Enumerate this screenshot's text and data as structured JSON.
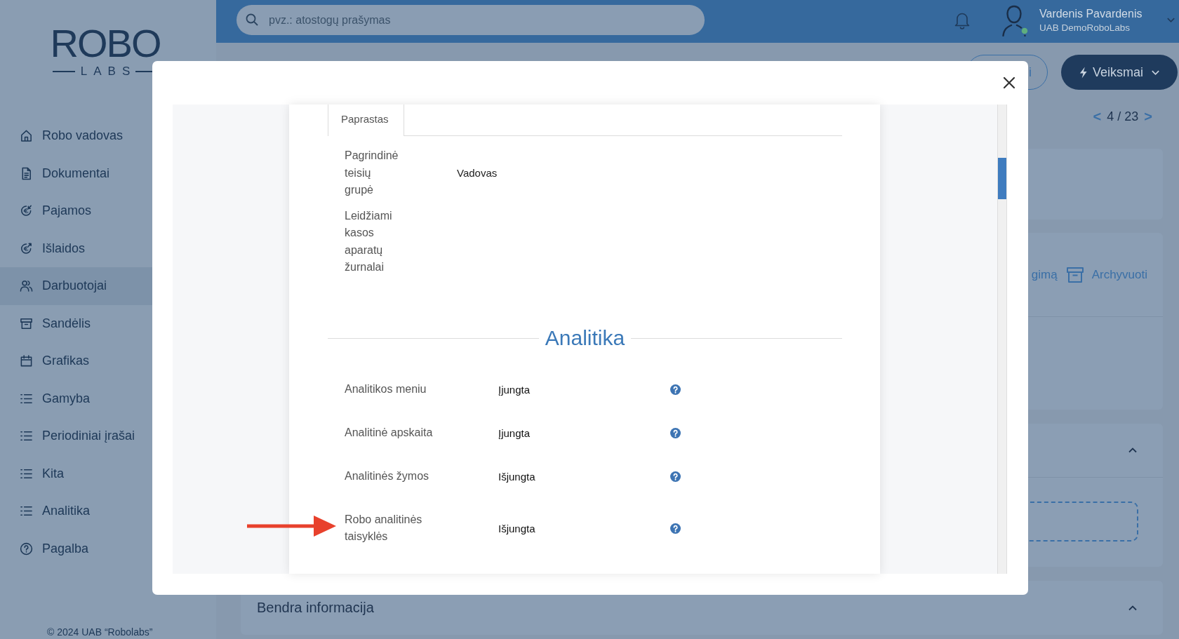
{
  "sidebar": {
    "logo": {
      "wordmark": "ROBO",
      "tagline": "LABS"
    },
    "items": [
      {
        "label": "Robo vadovas",
        "selected": false
      },
      {
        "label": "Dokumentai",
        "selected": false
      },
      {
        "label": "Pajamos",
        "selected": false
      },
      {
        "label": "Išlaidos",
        "selected": false
      },
      {
        "label": "Darbuotojai",
        "selected": true
      },
      {
        "label": "Sandėlis",
        "selected": false
      },
      {
        "label": "Grafikas",
        "selected": false
      },
      {
        "label": "Gamyba",
        "selected": false
      },
      {
        "label": "Periodiniai įrašai",
        "selected": false
      },
      {
        "label": "Kita",
        "selected": false
      },
      {
        "label": "Analitika",
        "selected": false
      },
      {
        "label": "Pagalba",
        "selected": false
      }
    ],
    "footer": "© 2024 UAB “Robolabs”"
  },
  "topbar": {
    "search": {
      "placeholder": "pvz.: atostogų prašymas"
    },
    "user": {
      "name": "Vardenis Pavardenis",
      "company": "UAB DemoRoboLabs",
      "online": true
    }
  },
  "toolbar": {
    "buttons": [
      {
        "label": "i",
        "kind": "outline"
      },
      {
        "label": "Veiksmai",
        "kind": "primary"
      }
    ],
    "pager": {
      "previous": "<",
      "position": "4 / 23",
      "next": ">"
    }
  },
  "cards": [
    {
      "kind": "blank"
    },
    {
      "kind": "actions",
      "partial_link": "gimą",
      "link": "Archyvuoti"
    },
    {
      "kind": "upload",
      "expanded": true
    },
    {
      "kind": "section",
      "title": "Bendra informacija",
      "expanded": true
    }
  ],
  "modal": {
    "tabs": [
      {
        "label": "Paprastas",
        "selected": true
      }
    ],
    "fields": [
      {
        "label": "Pagrindinė teisių grupė",
        "value": "Vadovas"
      },
      {
        "label": "Leidžiami kasos aparatų žurnalai"
      }
    ],
    "section": {
      "title": "Analitika",
      "rows": [
        {
          "label": "Analitikos meniu",
          "value": "Įjungta",
          "pointed_at": false
        },
        {
          "label": "Analitinė apskaita",
          "value": "Įjungta",
          "pointed_at": false
        },
        {
          "label": "Analitinės žymos",
          "value": "Išjungta",
          "pointed_at": false
        },
        {
          "label": "Robo analitinės taisyklės",
          "value": "Išjungta",
          "pointed_at": true
        }
      ]
    }
  }
}
